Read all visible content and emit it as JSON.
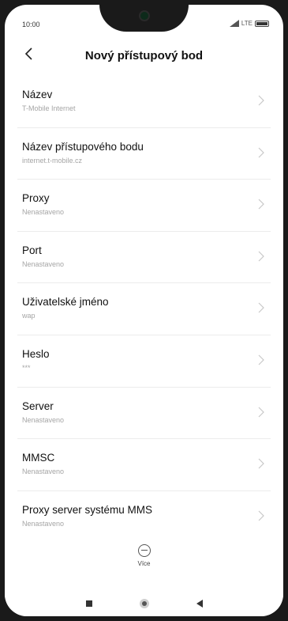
{
  "status": {
    "time": "10:00",
    "network": "LTE"
  },
  "header": {
    "back_icon": "chevron-left-icon",
    "title": "Nový přístupový bod"
  },
  "settings": [
    {
      "label": "Název",
      "value": "T-Mobile Internet"
    },
    {
      "label": "Název přístupového bodu",
      "value": "internet.t-mobile.cz"
    },
    {
      "label": "Proxy",
      "value": "Nenastaveno"
    },
    {
      "label": "Port",
      "value": "Nenastaveno"
    },
    {
      "label": "Uživatelské jméno",
      "value": "wap"
    },
    {
      "label": "Heslo",
      "value": "***"
    },
    {
      "label": "Server",
      "value": "Nenastaveno"
    },
    {
      "label": "MMSC",
      "value": "Nenastaveno"
    },
    {
      "label": "Proxy server systému MMS",
      "value": "Nenastaveno"
    }
  ],
  "more": {
    "icon": "minus-circle-icon",
    "label": "Více"
  },
  "nav": {
    "recents_icon": "square-icon",
    "home_icon": "circle-icon",
    "back_icon": "triangle-back-icon"
  },
  "colors": {
    "text_primary": "#111111",
    "text_secondary": "#a5a5a5",
    "divider": "#ececec",
    "background": "#ffffff"
  }
}
